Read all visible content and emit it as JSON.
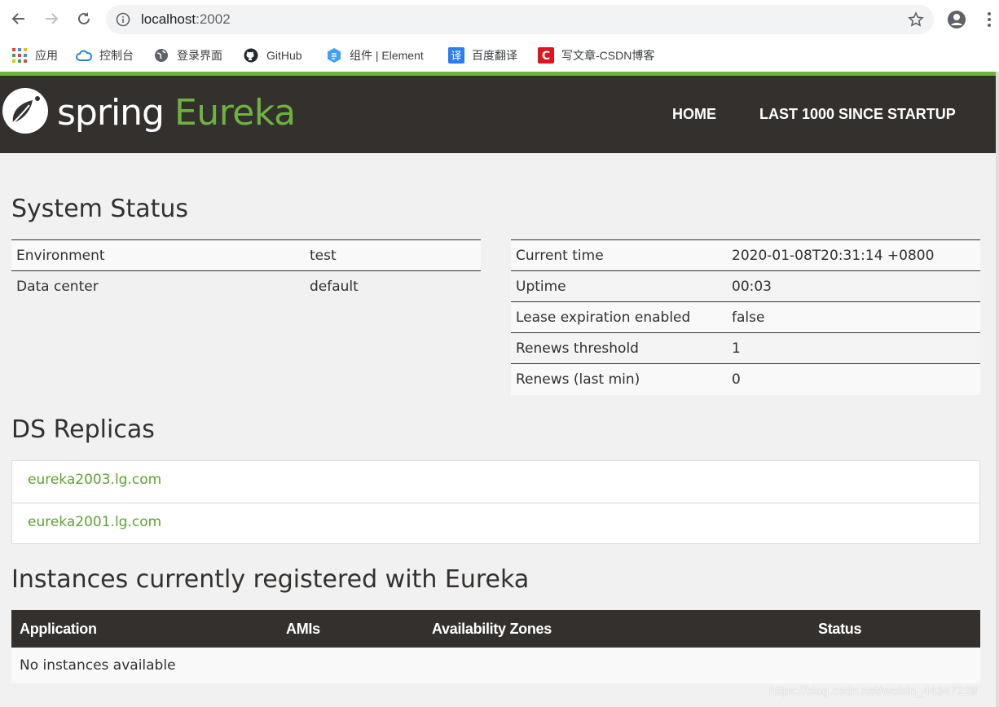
{
  "browser": {
    "url_host": "localhost",
    "url_port": ":2002",
    "bookmarks": [
      {
        "label": "应用",
        "icon": "apps-grid-icon"
      },
      {
        "label": "控制台",
        "icon": "cloud-icon"
      },
      {
        "label": "登录界面",
        "icon": "globe-icon"
      },
      {
        "label": "GitHub",
        "icon": "github-icon"
      },
      {
        "label": "组件 | Element",
        "icon": "element-icon"
      },
      {
        "label": "百度翻译",
        "icon": "translate-icon"
      },
      {
        "label": "写文章-CSDN博客",
        "icon": "csdn-icon"
      }
    ]
  },
  "navbar": {
    "logo_spring": "spring",
    "logo_eureka": "Eureka",
    "links": [
      "HOME",
      "LAST 1000 SINCE STARTUP"
    ]
  },
  "system_status": {
    "title": "System Status",
    "left": [
      {
        "label": "Environment",
        "value": "test"
      },
      {
        "label": "Data center",
        "value": "default"
      }
    ],
    "right": [
      {
        "label": "Current time",
        "value": "2020-01-08T20:31:14 +0800"
      },
      {
        "label": "Uptime",
        "value": "00:03"
      },
      {
        "label": "Lease expiration enabled",
        "value": "false"
      },
      {
        "label": "Renews threshold",
        "value": "1"
      },
      {
        "label": "Renews (last min)",
        "value": "0"
      }
    ]
  },
  "ds_replicas": {
    "title": "DS Replicas",
    "items": [
      "eureka2003.lg.com",
      "eureka2001.lg.com"
    ]
  },
  "instances": {
    "title": "Instances currently registered with Eureka",
    "columns": [
      "Application",
      "AMIs",
      "Availability Zones",
      "Status"
    ],
    "empty_message": "No instances available"
  },
  "watermark": "https://blog.csdn.net/weixin_44347229",
  "colors": {
    "brand_green": "#6db33f",
    "navbar_bg": "#34302d",
    "link_green": "#5fa134"
  }
}
